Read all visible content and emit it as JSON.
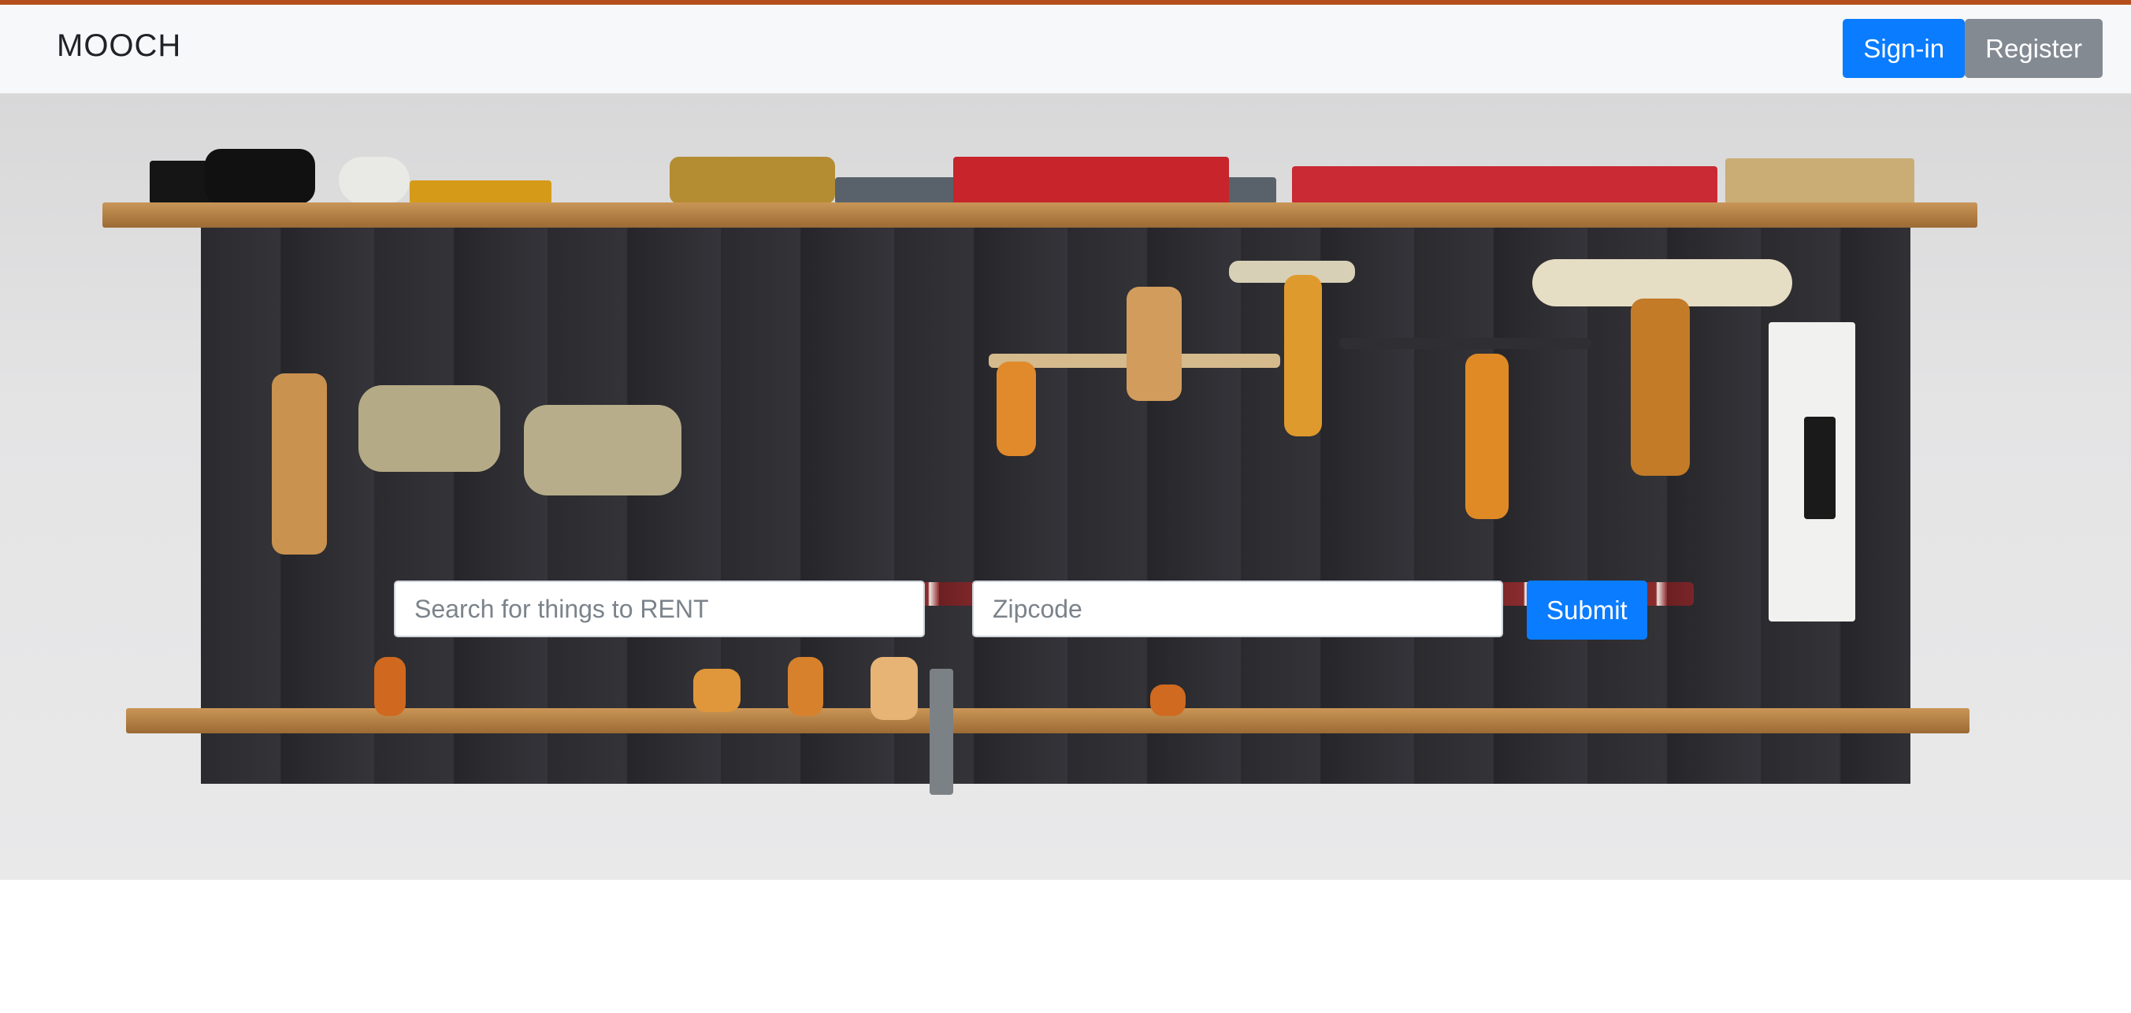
{
  "header": {
    "brand": "MOOCH",
    "signin_label": "Sign-in",
    "register_label": "Register"
  },
  "search": {
    "query_placeholder": "Search for things to RENT",
    "zipcode_placeholder": "Zipcode",
    "submit_label": "Submit"
  },
  "colors": {
    "primary": "#0a7cff",
    "secondary": "#848a92",
    "topline": "#b5501e"
  }
}
